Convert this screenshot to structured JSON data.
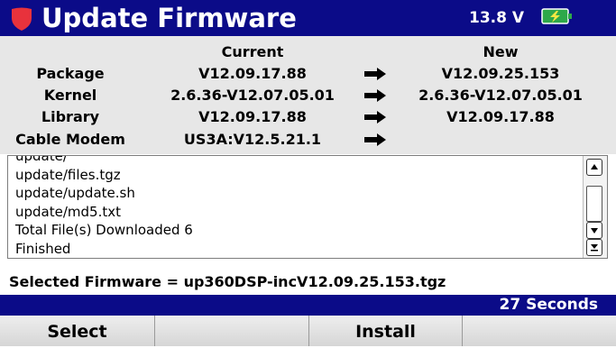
{
  "header": {
    "title": "Update Firmware",
    "voltage": "13.8 V",
    "accent_color": "#0b0b88",
    "shield_color": "#e8323c",
    "battery_color": "#2ea84a"
  },
  "versions": {
    "col_current": "Current",
    "col_new": "New",
    "rows": [
      {
        "label": "Package",
        "current": "V12.09.17.88",
        "new": "V12.09.25.153"
      },
      {
        "label": "Kernel",
        "current": "2.6.36-V12.07.05.01",
        "new": "2.6.36-V12.07.05.01"
      },
      {
        "label": "Library",
        "current": "V12.09.17.88",
        "new": "V12.09.17.88"
      },
      {
        "label": "Cable Modem",
        "current": "US3A:V12.5.21.1",
        "new": ""
      }
    ]
  },
  "log": {
    "lines": [
      "update/",
      "update/files.tgz",
      "update/update.sh",
      "update/md5.txt",
      "Total File(s) Downloaded 6",
      "Finished"
    ]
  },
  "selected_firmware": "Selected Firmware = up360DSP-incV12.09.25.153.tgz",
  "status_text": "27 Seconds",
  "softkeys": [
    "Select",
    "",
    "Install",
    ""
  ]
}
